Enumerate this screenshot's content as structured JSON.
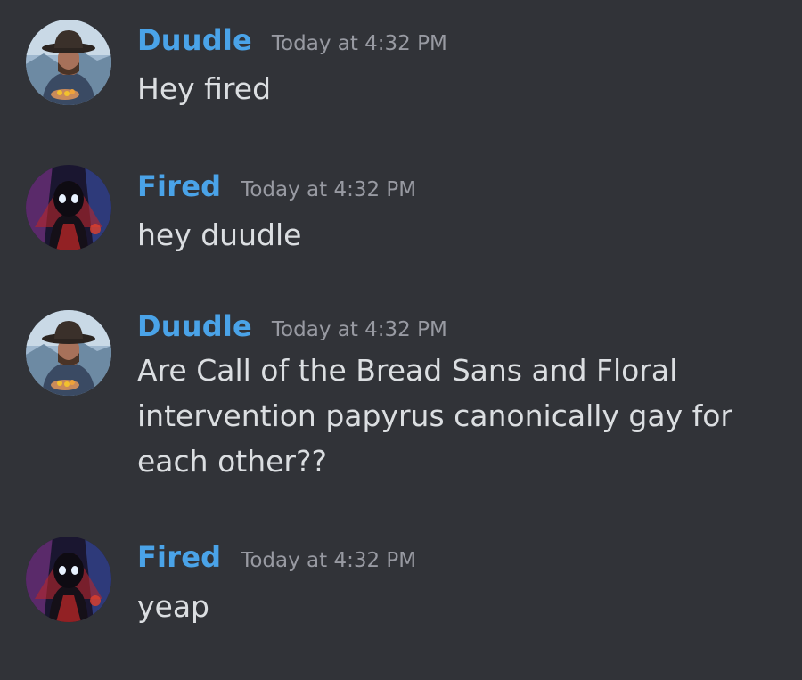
{
  "messages": [
    {
      "username": "Duudle",
      "timestamp": "Today at 4:32 PM",
      "lines": [
        "Hey fired"
      ],
      "avatar": "cowboy-avatar"
    },
    {
      "username": "Fired",
      "timestamp": "Today at 4:32 PM",
      "lines": [
        "hey duudle"
      ],
      "avatar": "spider-avatar"
    },
    {
      "username": "Duudle",
      "timestamp": "Today at 4:32 PM",
      "lines": [
        "Are Call of the Bread Sans and Floral",
        "intervention papyrus canonically gay for",
        "each other??"
      ],
      "avatar": "cowboy-avatar"
    },
    {
      "username": "Fired",
      "timestamp": "Today at 4:32 PM",
      "lines": [
        "yeap"
      ],
      "avatar": "spider-avatar"
    }
  ],
  "colors": {
    "background": "#313338",
    "username": "#4aa3e8",
    "timestamp": "#989aa2",
    "text": "#dbdee1"
  }
}
